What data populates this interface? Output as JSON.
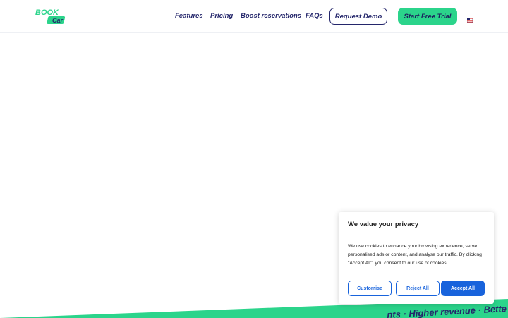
{
  "header": {
    "logo": {
      "line1": "BOOK",
      "line2": "Car",
      "icon": "bookcar-logo"
    },
    "nav": [
      {
        "label": "Features"
      },
      {
        "label": "Pricing"
      },
      {
        "label": "Boost reservations"
      },
      {
        "label": "FAQs"
      }
    ],
    "request_demo_label": "Request Demo",
    "start_trial_label": "Start Free Trial",
    "language_icon": "flag-icon"
  },
  "band": {
    "text": "nts · Higher revenue · Bette"
  },
  "cookie": {
    "title": "We value your privacy",
    "body": "We use cookies to enhance your browsing experience, serve personalised ads or content, and analyse our traffic. By clicking \"Accept All\", you consent to our use of cookies.",
    "customise_label": "Customise",
    "reject_label": "Reject All",
    "accept_label": "Accept All"
  },
  "colors": {
    "brand_green": "#2bd48b",
    "brand_navy": "#24266b",
    "cookie_blue": "#1863dc"
  }
}
